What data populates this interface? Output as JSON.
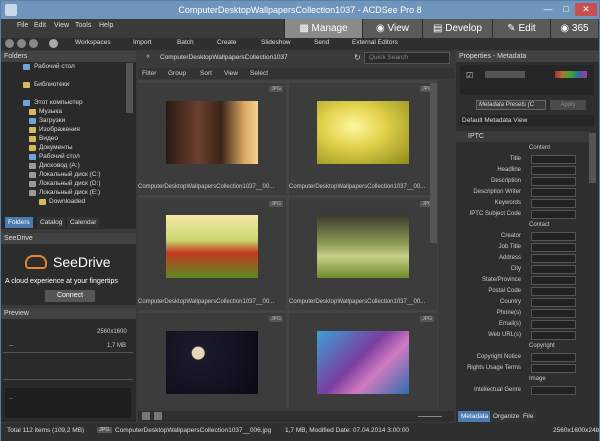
{
  "title": "ComputerDesktopWallpapersCollection1037 - ACDSee Pro 8",
  "menu": [
    "File",
    "Edit",
    "View",
    "Tools",
    "Help"
  ],
  "modes": {
    "manage": "Manage",
    "view": "View",
    "develop": "Develop",
    "edit": "Edit",
    "online": "365"
  },
  "toolbar": [
    "Workspaces",
    "Import",
    "Batch",
    "Create",
    "Slideshow",
    "Send",
    "External Editors"
  ],
  "folders": {
    "header": "Folders",
    "items": [
      "Рабочий стол",
      "Библиотеки",
      "Этот компьютер",
      "Музыка",
      "Загрузки",
      "Изображения",
      "Видео",
      "Документы",
      "Рабочий стол",
      "Дисковод (A:)",
      "Локальный диск (C:)",
      "Локальный диск (D:)",
      "Локальный диск (E:)",
      "Downloaded"
    ],
    "tabs": [
      "Folders",
      "Catalog",
      "Calendar"
    ]
  },
  "seedrive": {
    "header": "SeeDrive",
    "logo": "SeeDrive",
    "tagline": "A cloud experience at your fingertips",
    "button": "Connect"
  },
  "preview": {
    "header": "Preview",
    "dims": "2560x1600",
    "size": "1,7 MB",
    "blank": "--",
    "histogram": "--"
  },
  "path": "ComputerDesktopWallpapersCollection1037",
  "quick_search": "Quick Search",
  "filterbar": [
    "Filter",
    "Group",
    "Sort",
    "View",
    "Select"
  ],
  "files": [
    {
      "caption": "ComputerDesktopWallpapersCollection1037__00...",
      "badge": "JPG"
    },
    {
      "caption": "ComputerDesktopWallpapersCollection1037__00...",
      "badge": "JPG"
    },
    {
      "caption": "ComputerDesktopWallpapersCollection1037__00...",
      "badge": "JPG"
    },
    {
      "caption": "ComputerDesktopWallpapersCollection1037__00...",
      "badge": "JPG"
    },
    {
      "caption": "",
      "badge": "JPG"
    },
    {
      "caption": "",
      "badge": "JPG"
    }
  ],
  "properties": {
    "header": "Properties - Metadata",
    "preset": "Metadata Presets (C",
    "apply": "Apply",
    "view": "Default Metadata View",
    "section": "IPTC",
    "groups": [
      {
        "name": "Content",
        "fields": [
          "Title",
          "Headline",
          "Description",
          "Description Writer",
          "Keywords",
          "IPTC Subject Code"
        ]
      },
      {
        "name": "Contact",
        "fields": [
          "Creator",
          "Job Title",
          "Address",
          "City",
          "State/Province",
          "Postal Code",
          "Country",
          "Phone(s)",
          "Email(s)",
          "Web URL(s)"
        ]
      },
      {
        "name": "Copyright",
        "fields": [
          "Copyright Notice",
          "Rights Usage Terms"
        ]
      },
      {
        "name": "Image",
        "fields": [
          "Intellectual Genre"
        ]
      }
    ],
    "tabs": [
      "Metadata",
      "Organize",
      "File"
    ]
  },
  "status": {
    "total": "Total 112 items (109,2 MB)",
    "badge": "JPG",
    "file": "ComputerDesktopWallpapersCollection1037__006.jpg",
    "info": "1,7 MB, Modified Date: 07.04.2014 3:00:00",
    "dims": "2560x1600x24b"
  }
}
